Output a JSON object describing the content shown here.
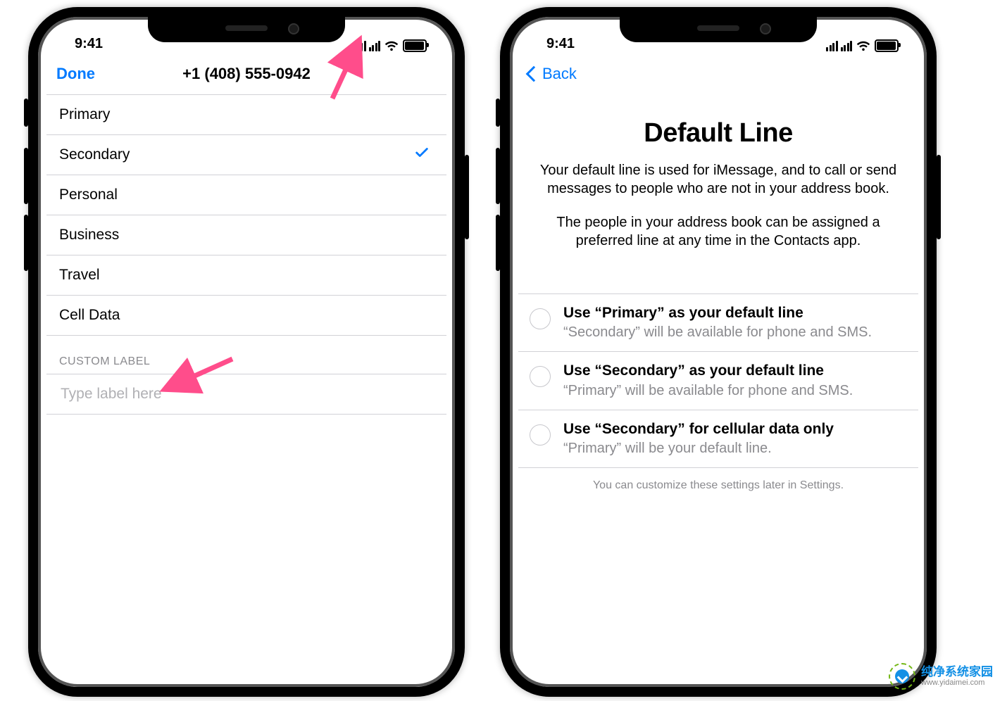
{
  "status": {
    "time": "9:41"
  },
  "left": {
    "nav": {
      "done": "Done",
      "title": "+1 (408) 555-0942"
    },
    "labels": [
      "Primary",
      "Secondary",
      "Personal",
      "Business",
      "Travel",
      "Cell Data"
    ],
    "selected_index": 1,
    "custom_header": "CUSTOM LABEL",
    "input_placeholder": "Type label here"
  },
  "right": {
    "nav": {
      "back": "Back"
    },
    "headline": "Default Line",
    "para1": "Your default line is used for iMessage, and to call or send messages to people who are not in your address book.",
    "para2": "The people in your address book can be assigned a preferred line at any time in the Contacts app.",
    "options": [
      {
        "title": "Use “Primary” as your default line",
        "sub": "“Secondary” will be available for phone and SMS."
      },
      {
        "title": "Use “Secondary” as your default line",
        "sub": "“Primary” will be available for phone and SMS."
      },
      {
        "title": "Use “Secondary” for cellular data only",
        "sub": "“Primary” will be your default line."
      }
    ],
    "footnote": "You can customize these settings later in Settings."
  },
  "watermark": {
    "name": "纯净系统家园",
    "url": "www.yidaimei.com"
  }
}
